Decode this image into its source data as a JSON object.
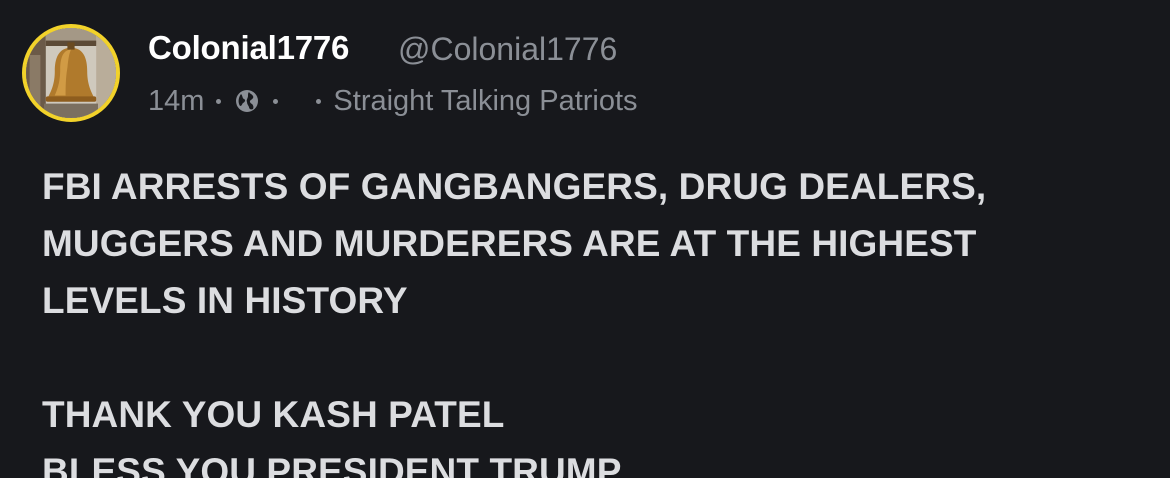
{
  "post": {
    "author": {
      "display_name": "Colonial1776",
      "handle": "@Colonial1776",
      "avatar_icon": "liberty-bell-icon",
      "avatar_ring_color": "#f2d22a"
    },
    "meta": {
      "time": "14m",
      "visibility_icon": "globe-icon",
      "community": "Straight Talking Patriots"
    },
    "body": {
      "paragraph_1": [
        "FBI ARRESTS OF GANGBANGERS, DRUG DEALERS,",
        "MUGGERS AND MURDERERS ARE AT THE HIGHEST",
        "LEVELS IN HISTORY"
      ],
      "paragraph_2": [
        "THANK YOU KASH PATEL",
        "BLESS YOU PRESIDENT TRUMP"
      ]
    }
  },
  "colors": {
    "background": "#17181c",
    "primary_text": "#ffffff",
    "secondary_text": "#8b8f96",
    "body_text": "#dcdde0"
  }
}
